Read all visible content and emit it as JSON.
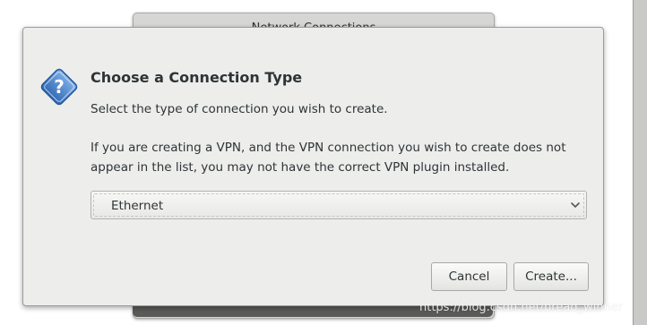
{
  "background_window": {
    "title": "Network Connections"
  },
  "dialog": {
    "icon": "question-icon",
    "heading": "Choose a Connection Type",
    "subtitle": "Select the type of connection you wish to create.",
    "note": "If you are creating a VPN, and the VPN connection you wish to create does not appear in the list, you may not have the correct VPN plugin installed.",
    "connection_type": {
      "selected": "Ethernet",
      "arrow_icon": "chevron-down-icon"
    },
    "buttons": {
      "cancel": "Cancel",
      "create": "Create..."
    }
  },
  "watermark": "https://blog.csdn.net/bread_winner",
  "colors": {
    "dialog_bg": "#ededec",
    "icon_blue": "#3b78c3",
    "text": "#2e3436"
  }
}
